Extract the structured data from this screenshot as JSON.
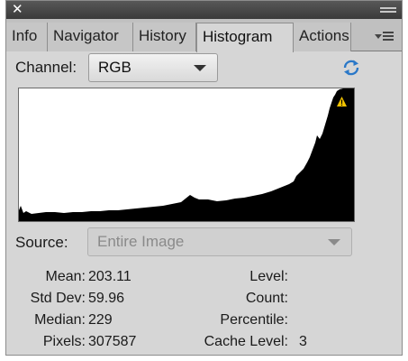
{
  "window": {
    "close_glyph": "✕"
  },
  "tabs": [
    {
      "label": "Info",
      "active": false
    },
    {
      "label": "Navigator",
      "active": false
    },
    {
      "label": "History",
      "active": false
    },
    {
      "label": "Histogram",
      "active": true
    },
    {
      "label": "Actions",
      "active": false
    }
  ],
  "channel": {
    "label": "Channel:",
    "value": "RGB"
  },
  "source": {
    "label": "Source:",
    "value": "Entire Image",
    "disabled": true
  },
  "histogram": {
    "clipping_warning": "!",
    "fill_color": "#000000",
    "background_color": "#ffffff",
    "warning_color": "#f2c200"
  },
  "stats": {
    "mean": {
      "label": "Mean:",
      "value": "203.11"
    },
    "std_dev": {
      "label": "Std Dev:",
      "value": "59.96"
    },
    "median": {
      "label": "Median:",
      "value": "229"
    },
    "pixels": {
      "label": "Pixels:",
      "value": "307587"
    },
    "level": {
      "label": "Level:",
      "value": ""
    },
    "count": {
      "label": "Count:",
      "value": ""
    },
    "percentile": {
      "label": "Percentile:",
      "value": ""
    },
    "cache_level": {
      "label": "Cache Level:",
      "value": "3"
    }
  },
  "icons": {
    "refresh": "refresh-icon",
    "panel_menu": "panel-menu-icon",
    "collapse": "collapse-icon",
    "close": "close-icon"
  },
  "colors": {
    "accent": "#2a78c8",
    "panel": "#d6d6d6",
    "titlebar": "#484848"
  }
}
